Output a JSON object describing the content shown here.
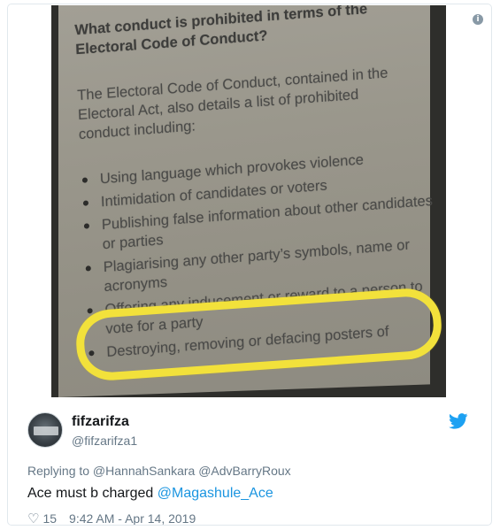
{
  "photo": {
    "heading_line1": "What conduct is prohibited in terms of the",
    "heading_line2": "Electoral Code of Conduct?",
    "para_line1": "The Electoral Code of Conduct, contained in the",
    "para_line2": "Electoral Act, also details a list of prohibited",
    "para_line3": "conduct including:",
    "bullets": [
      "Using language which provokes violence",
      "Intimidation of candidates or voters",
      "Publishing false information about other candidates or parties",
      "Plagiarising any other party’s symbols, name or acronyms",
      "Offering any inducement or reward to a person to vote for a party",
      "Destroying, removing or defacing posters of"
    ],
    "highlight_color": "#f2e13b"
  },
  "tweet": {
    "author_name": "fifzarifza",
    "author_handle": "@fifzarifza1",
    "replying_to": "Replying to @HannahSankara @AdvBarryRoux",
    "text_main": "Ace must b charged ",
    "text_mention": "@Magashule_Ace",
    "likes": "15",
    "timestamp": "9:42 AM - Apr 14, 2019"
  },
  "icons": {
    "info": "info-icon",
    "bird": "twitter-bird-icon",
    "heart": "heart-icon"
  },
  "colors": {
    "link": "#1b95e0",
    "muted": "#657786",
    "text": "#14171a"
  }
}
